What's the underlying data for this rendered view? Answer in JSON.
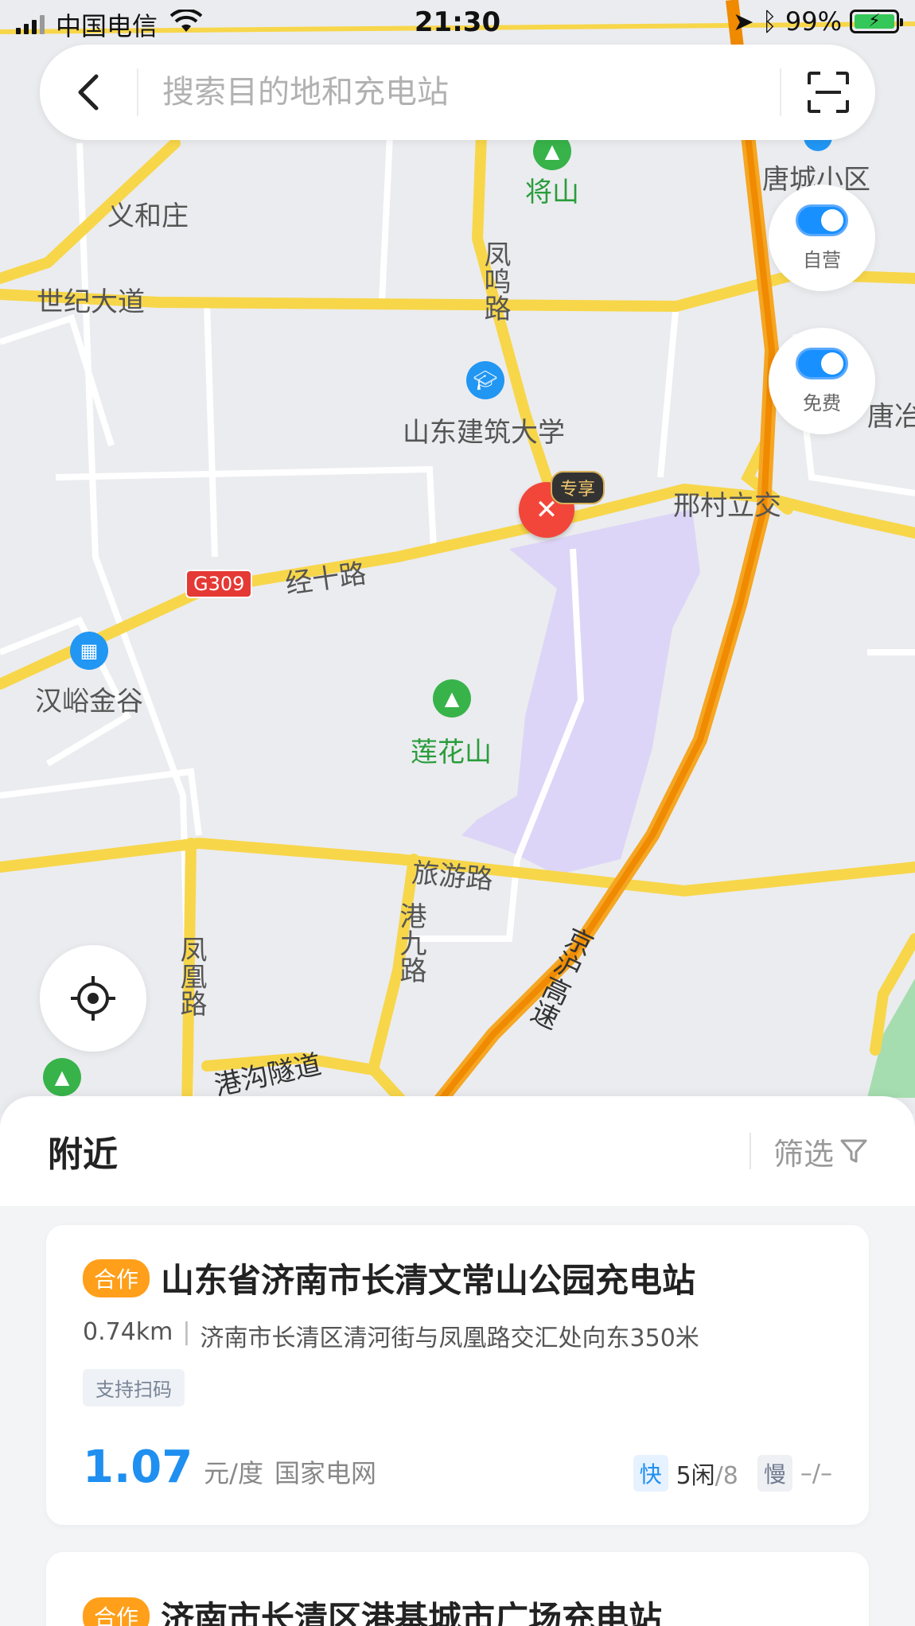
{
  "status_bar": {
    "carrier": "中国电信",
    "time": "21:30",
    "battery": "99%"
  },
  "search": {
    "placeholder": "搜索目的地和充电站"
  },
  "toggles": [
    {
      "label": "自营"
    },
    {
      "label": "免费"
    }
  ],
  "map": {
    "labels": {
      "jiangshan": "将山",
      "tangcheng": "唐城小区",
      "yihezhuang": "义和庄",
      "shiji": "世纪大道",
      "fengming": "凤鸣路",
      "university": "山东建筑大学",
      "tangye": "唐冶",
      "xingcun": "邢村立交",
      "jingshi": "经十路",
      "g309": "G309",
      "hanyu": "汉峪金谷",
      "lianhua": "莲花山",
      "lvyou": "旅游路",
      "gangjiu": "港九路",
      "fenghuang": "凤凰路",
      "jinghu": "京沪高速",
      "tunnel": "港沟隧道",
      "exclusive": "专享"
    }
  },
  "sheet": {
    "title": "附近",
    "filter_label": "筛选"
  },
  "stations": [
    {
      "badge": "合作",
      "name": "山东省济南市长清文常山公园充电站",
      "distance": "0.74km",
      "address": "济南市长清区清河街与凤凰路交汇处向东350米",
      "tag": "支持扫码",
      "price": "1.07",
      "unit": "元/度",
      "operator": "国家电网",
      "fast_label": "快",
      "fast_free": "5闲",
      "fast_total": "/8",
      "slow_label": "慢",
      "slow_value": "–/–"
    },
    {
      "badge": "合作",
      "name": "济南市长清区港基城市广场充电站"
    }
  ],
  "colors": {
    "accent": "#1f8ff0",
    "coop_badge": "#ff9f1a",
    "marker": "#f2463a"
  }
}
